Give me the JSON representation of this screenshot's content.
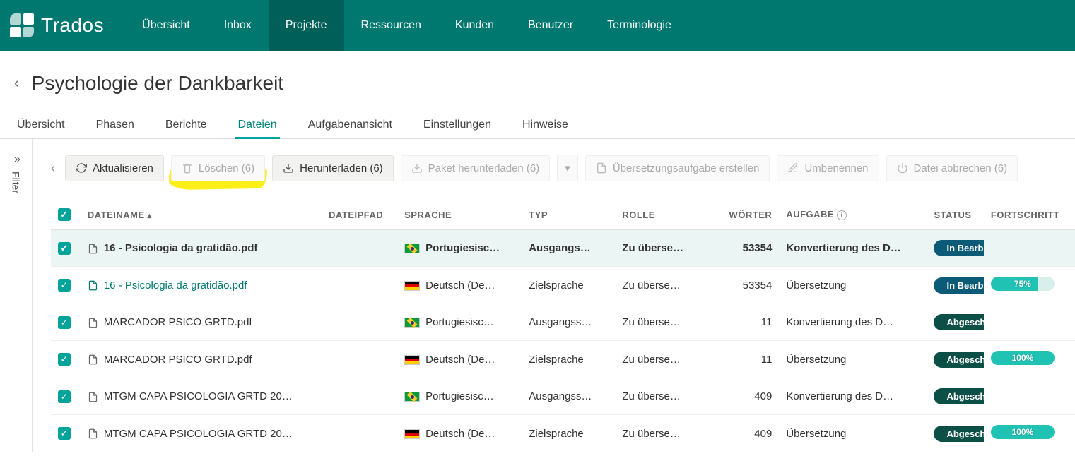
{
  "app": {
    "name": "Trados"
  },
  "topnav": [
    {
      "label": "Übersicht",
      "active": false
    },
    {
      "label": "Inbox",
      "active": false
    },
    {
      "label": "Projekte",
      "active": true
    },
    {
      "label": "Ressourcen",
      "active": false
    },
    {
      "label": "Kunden",
      "active": false
    },
    {
      "label": "Benutzer",
      "active": false
    },
    {
      "label": "Terminologie",
      "active": false
    }
  ],
  "project": {
    "title": "Psychologie der Dankbarkeit"
  },
  "subtabs": [
    {
      "label": "Übersicht",
      "active": false
    },
    {
      "label": "Phasen",
      "active": false
    },
    {
      "label": "Berichte",
      "active": false
    },
    {
      "label": "Dateien",
      "active": true
    },
    {
      "label": "Aufgabenansicht",
      "active": false
    },
    {
      "label": "Einstellungen",
      "active": false
    },
    {
      "label": "Hinweise",
      "active": false
    }
  ],
  "filter_rail": {
    "label": "Filter"
  },
  "toolbar": {
    "refresh": "Aktualisieren",
    "delete": "Löschen (6)",
    "download": "Herunterladen (6)",
    "download_package": "Paket herunterladen (6)",
    "create_task": "Übersetzungsaufgabe erstellen",
    "rename": "Umbenennen",
    "cancel_file": "Datei abbrechen (6)"
  },
  "table": {
    "headers": {
      "filename": "DATEINAME",
      "filepath": "DATEIPFAD",
      "language": "SPRACHE",
      "type": "TYP",
      "role": "ROLLE",
      "words": "WÖRTER",
      "task": "AUFGABE",
      "status": "STATUS",
      "progress": "FORTSCHRITT"
    },
    "rows": [
      {
        "selected": true,
        "bold": true,
        "file": "16 - Psicologia da gratidão.pdf",
        "link": false,
        "flag": "br",
        "language": "Portugiesisc…",
        "type": "Ausgangs…",
        "role": "Zu überse…",
        "words": "53354",
        "task": "Konvertierung des D…",
        "status": "In Bearbeitung",
        "status_kind": "inprog",
        "progress": null
      },
      {
        "selected": true,
        "bold": false,
        "file": "16 - Psicologia da gratidão.pdf",
        "link": true,
        "flag": "de",
        "language": "Deutsch (De…",
        "type": "Zielsprache",
        "role": "Zu überse…",
        "words": "53354",
        "task": "Übersetzung",
        "status": "In Bearbeitung",
        "status_kind": "inprog",
        "progress": 75
      },
      {
        "selected": true,
        "bold": false,
        "file": "MARCADOR PSICO GRTD.pdf",
        "link": false,
        "flag": "br",
        "language": "Portugiesisc…",
        "type": "Ausgangss…",
        "role": "Zu überse…",
        "words": "11",
        "task": "Konvertierung des D…",
        "status": "Abgeschlossen",
        "status_kind": "done",
        "progress": null
      },
      {
        "selected": true,
        "bold": false,
        "file": "MARCADOR PSICO GRTD.pdf",
        "link": false,
        "flag": "de",
        "language": "Deutsch (De…",
        "type": "Zielsprache",
        "role": "Zu überse…",
        "words": "11",
        "task": "Übersetzung",
        "status": "Abgeschlossen",
        "status_kind": "done",
        "progress": 100
      },
      {
        "selected": true,
        "bold": false,
        "file": "MTGM CAPA PSICOLOGIA GRTD 20…",
        "link": false,
        "flag": "br",
        "language": "Portugiesisc…",
        "type": "Ausgangss…",
        "role": "Zu überse…",
        "words": "409",
        "task": "Konvertierung des D…",
        "status": "Abgeschlossen",
        "status_kind": "done",
        "progress": null
      },
      {
        "selected": true,
        "bold": false,
        "file": "MTGM CAPA PSICOLOGIA GRTD 20…",
        "link": false,
        "flag": "de",
        "language": "Deutsch (De…",
        "type": "Zielsprache",
        "role": "Zu überse…",
        "words": "409",
        "task": "Übersetzung",
        "status": "Abgeschlossen",
        "status_kind": "done",
        "progress": 100
      }
    ]
  }
}
